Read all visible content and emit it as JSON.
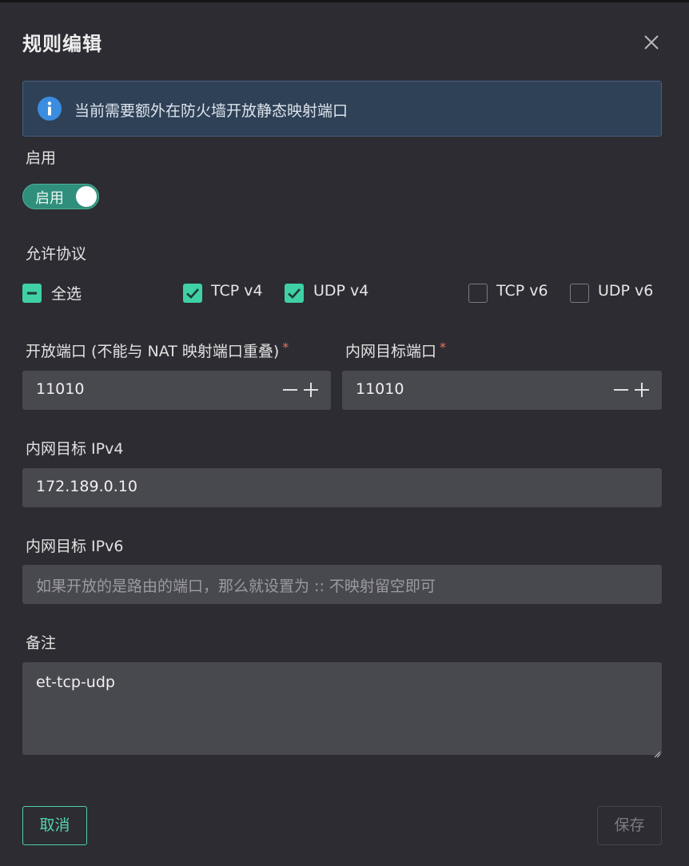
{
  "dialog": {
    "title": "规则编辑"
  },
  "alert": {
    "text": "当前需要额外在防火墙开放静态映射端口",
    "icon": "info-icon",
    "color": "#2f4157"
  },
  "enable": {
    "label": "启用",
    "switch_text": "启用",
    "on": true,
    "accent": "#2f8f7c"
  },
  "protocols": {
    "label": "允许协议",
    "select_all": {
      "label": "全选",
      "state": "indeterminate"
    },
    "items": [
      {
        "label": "TCP v4",
        "checked": true
      },
      {
        "label": "UDP v4",
        "checked": true
      },
      {
        "label": "TCP v6",
        "checked": false
      },
      {
        "label": "UDP v6",
        "checked": false
      }
    ],
    "check_color": "#3fd0a6"
  },
  "open_port": {
    "label": "开放端口 (不能与 NAT 映射端口重叠)",
    "required": "*",
    "value": "11010"
  },
  "target_port": {
    "label": "内网目标端口",
    "required": "*",
    "value": "11010"
  },
  "ipv4": {
    "label": "内网目标 IPv4",
    "value": "172.189.0.10"
  },
  "ipv6": {
    "label": "内网目标 IPv6",
    "placeholder": "如果开放的是路由的端口，那么就设置为 :: 不映射留空即可"
  },
  "remark": {
    "label": "备注",
    "value": "et-tcp-udp"
  },
  "footer": {
    "cancel_label": "取消",
    "save_label": "保存",
    "accent": "#4fcfa9"
  }
}
